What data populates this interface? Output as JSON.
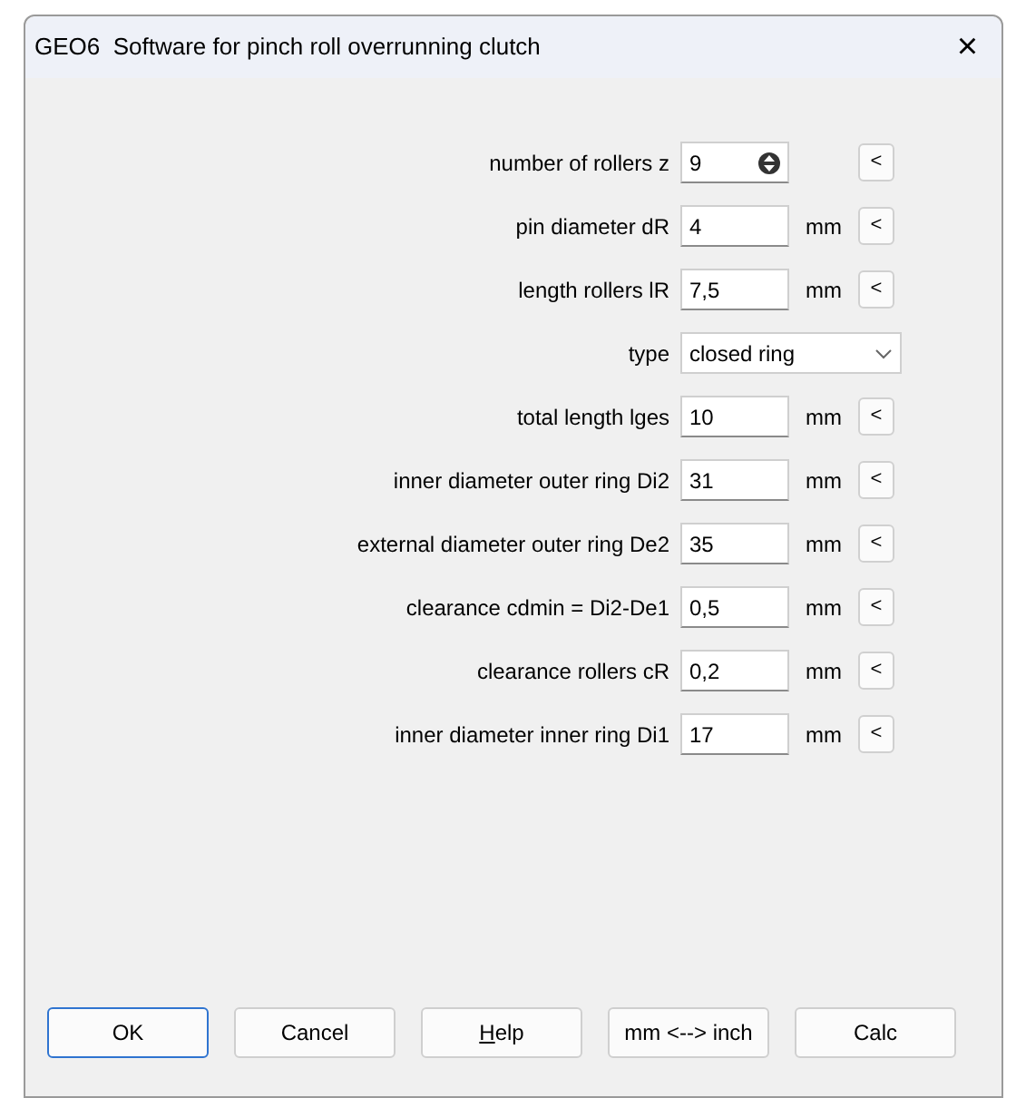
{
  "window": {
    "title": "GEO6  Software for pinch roll overrunning clutch",
    "close": "×"
  },
  "rows": [
    {
      "kind": "spinner",
      "label": "number of rollers z",
      "value": "9",
      "button": "<"
    },
    {
      "kind": "field",
      "label": "pin diameter dR",
      "value": "4",
      "unit": "mm",
      "button": "<"
    },
    {
      "kind": "field",
      "label": "length rollers lR",
      "value": "7,5",
      "unit": "mm",
      "button": "<"
    },
    {
      "kind": "select",
      "label": "type",
      "value": "closed ring"
    },
    {
      "kind": "field",
      "label": "total length lges",
      "value": "10",
      "unit": "mm",
      "button": "<"
    },
    {
      "kind": "field",
      "label": "inner diameter outer ring Di2",
      "value": "31",
      "unit": "mm",
      "button": "<"
    },
    {
      "kind": "field",
      "label": "external diameter outer ring De2",
      "value": "35",
      "unit": "mm",
      "button": "<"
    },
    {
      "kind": "field",
      "label": "clearance cdmin = Di2-De1",
      "value": "0,5",
      "unit": "mm",
      "button": "<"
    },
    {
      "kind": "field",
      "label": "clearance rollers cR",
      "value": "0,2",
      "unit": "mm",
      "button": "<"
    },
    {
      "kind": "field",
      "label": "inner diameter inner ring Di1",
      "value": "17",
      "unit": "mm",
      "button": "<"
    }
  ],
  "buttons": [
    {
      "label": "OK",
      "default": true,
      "underline_first": false
    },
    {
      "label": "Cancel",
      "default": false,
      "underline_first": false
    },
    {
      "label": "Help",
      "default": false,
      "underline_first": true
    },
    {
      "label": "mm <--> inch",
      "default": false,
      "underline_first": false
    },
    {
      "label": "Calc",
      "default": false,
      "underline_first": false
    }
  ]
}
